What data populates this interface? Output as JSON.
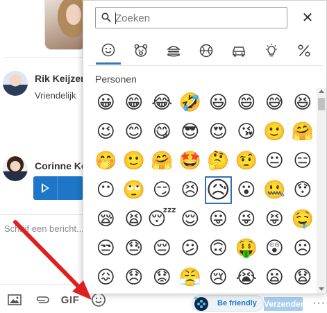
{
  "chat": {
    "messages": [
      {
        "sender": "Rik Keijzer",
        "text": "Vriendelijk"
      },
      {
        "sender": "Corinne Ke",
        "text": ""
      }
    ],
    "compose_placeholder": "Schrijf een bericht...",
    "toolbar": {
      "gif_label": "GIF",
      "befriendly_label": "Be friendly",
      "send_label": "Verzenden",
      "more_label": "···"
    }
  },
  "picker": {
    "search_placeholder": "Zoeken",
    "close_label": "✕",
    "categories": [
      {
        "name": "smileys",
        "active": true
      },
      {
        "name": "animals",
        "active": false
      },
      {
        "name": "food",
        "active": false
      },
      {
        "name": "activity",
        "active": false
      },
      {
        "name": "travel",
        "active": false
      },
      {
        "name": "objects",
        "active": false
      },
      {
        "name": "symbols",
        "active": false
      }
    ],
    "section_title": "Personen",
    "emoji_rows": [
      [
        "😀",
        "😁",
        "😂",
        "🤣",
        "😃",
        "😄",
        "😅",
        "😆"
      ],
      [
        "😉",
        "😊",
        "😋",
        "😎",
        "😍",
        "😘",
        "🙂",
        "🤗"
      ],
      [
        "🤭",
        "🙂",
        "🤗",
        "🤩",
        "🤔",
        "🤨",
        "😐",
        "😑"
      ],
      [
        "😶",
        "🙄",
        "😏",
        "😣",
        "😥",
        "😮",
        "🤐",
        "😯"
      ],
      [
        "😪",
        "😫",
        "😴",
        "😌",
        "😛",
        "😜",
        "😝",
        "🤤"
      ],
      [
        "😒",
        "😓",
        "😔",
        "😕",
        "🙃",
        "🤑",
        "😲",
        "☹"
      ],
      [
        "😖",
        "😞",
        "😟",
        "😤",
        "😢",
        "😭",
        "😦",
        "😧"
      ]
    ],
    "highlighted": {
      "row": 3,
      "col": 4
    }
  },
  "colors": {
    "accent": "#3d74b4",
    "arrow": "#e02020",
    "send_bg": "#a9cdee",
    "video_box": "#1d76c7"
  }
}
